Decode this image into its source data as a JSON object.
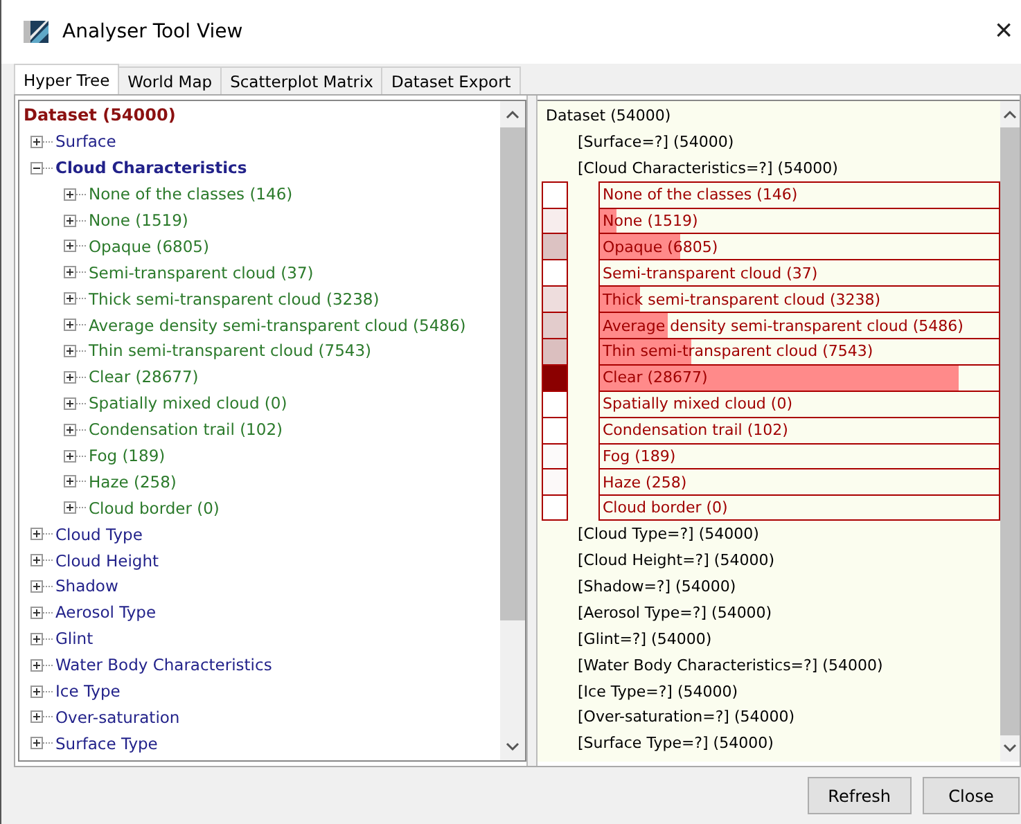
{
  "window": {
    "title": "Analyser Tool View",
    "close": "×"
  },
  "tabs": [
    {
      "label": "Hyper Tree",
      "selected": true
    },
    {
      "label": "World Map",
      "selected": false
    },
    {
      "label": "Scatterplot Matrix",
      "selected": false
    },
    {
      "label": "Dataset Export",
      "selected": false
    }
  ],
  "tree": {
    "root": "Dataset (54000)",
    "items": [
      {
        "label": "Surface",
        "expanded": false
      },
      {
        "label": "Cloud Characteristics",
        "expanded": true,
        "children": [
          {
            "label": "None of the classes (146)",
            "expanded": false
          },
          {
            "label": "None (1519)",
            "expanded": false
          },
          {
            "label": "Opaque (6805)",
            "expanded": false
          },
          {
            "label": "Semi-transparent cloud (37)",
            "expanded": false
          },
          {
            "label": "Thick semi-transparent cloud (3238)",
            "expanded": false
          },
          {
            "label": "Average density semi-transparent cloud (5486)",
            "expanded": false
          },
          {
            "label": "Thin semi-transparent cloud (7543)",
            "expanded": false
          },
          {
            "label": "Clear (28677)",
            "expanded": false
          },
          {
            "label": "Spatially mixed cloud (0)",
            "expanded": false
          },
          {
            "label": "Condensation trail (102)",
            "expanded": false
          },
          {
            "label": "Fog (189)",
            "expanded": false
          },
          {
            "label": "Haze (258)",
            "expanded": false
          },
          {
            "label": "Cloud border (0)",
            "expanded": false
          }
        ]
      },
      {
        "label": "Cloud Type",
        "expanded": false
      },
      {
        "label": "Cloud Height",
        "expanded": false
      },
      {
        "label": "Shadow",
        "expanded": false
      },
      {
        "label": "Aerosol Type",
        "expanded": false
      },
      {
        "label": "Glint",
        "expanded": false
      },
      {
        "label": "Water Body Characteristics",
        "expanded": false
      },
      {
        "label": "Ice Type",
        "expanded": false
      },
      {
        "label": "Over-saturation",
        "expanded": false
      },
      {
        "label": "Surface Type",
        "expanded": false
      }
    ]
  },
  "hyper_tree": {
    "root": "Dataset (54000)",
    "nodes": [
      {
        "label": "[Surface=?] (54000)"
      },
      {
        "label": "[Cloud Characteristics=?] (54000)",
        "classes": [
          {
            "label": "None of the classes (146)",
            "color": "#ffffff"
          },
          {
            "label": "None (1519)",
            "level": 0.04,
            "color": "#f7eded"
          },
          {
            "label": "Opaque (6805)",
            "level": 0.2,
            "color": "#dcc2c2"
          },
          {
            "label": "Semi-transparent cloud (37)",
            "color": "#ffffff"
          },
          {
            "label": "Thick semi-transparent cloud (3238)",
            "level": 0.1,
            "color": "#eedddd"
          },
          {
            "label": "Average density semi-transparent cloud (5486)",
            "level": 0.17,
            "color": "#e3cccc"
          },
          {
            "label": "Thin semi-transparent cloud (7543)",
            "level": 0.23,
            "color": "#dbbfbf"
          },
          {
            "label": "Clear (28677)",
            "level": 0.9,
            "color": "#8b0000"
          },
          {
            "label": "Spatially mixed cloud (0)",
            "color": "#ffffff"
          },
          {
            "label": "Condensation trail (102)",
            "color": "#ffffff"
          },
          {
            "label": "Fog (189)",
            "color": "#fcfafa"
          },
          {
            "label": "Haze (258)",
            "color": "#fcf9f9"
          },
          {
            "label": "Cloud border (0)",
            "color": "#ffffff"
          }
        ]
      },
      {
        "label": "[Cloud Type=?] (54000)"
      },
      {
        "label": "[Cloud Height=?] (54000)"
      },
      {
        "label": "[Shadow=?] (54000)"
      },
      {
        "label": "[Aerosol Type=?] (54000)"
      },
      {
        "label": "[Glint=?] (54000)"
      },
      {
        "label": "[Water Body Characteristics=?] (54000)"
      },
      {
        "label": "[Ice Type=?] (54000)"
      },
      {
        "label": "[Over-saturation=?] (54000)"
      },
      {
        "label": "[Surface Type=?] (54000)"
      }
    ]
  },
  "buttons": [
    "Refresh",
    "Close"
  ]
}
